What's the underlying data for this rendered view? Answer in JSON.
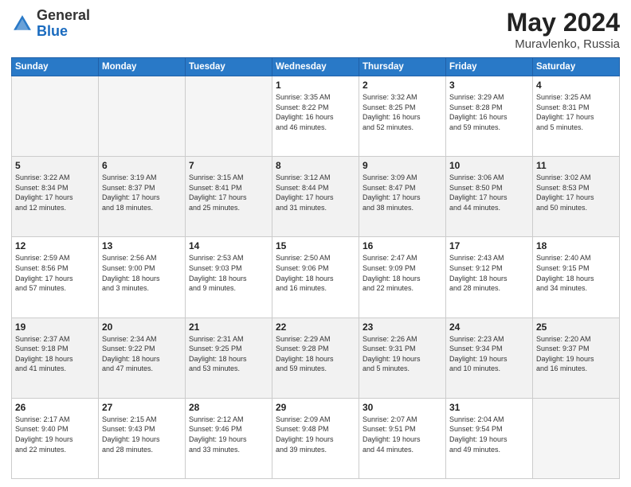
{
  "header": {
    "logo_general": "General",
    "logo_blue": "Blue",
    "title": "May 2024",
    "location": "Muravlenko, Russia"
  },
  "days_of_week": [
    "Sunday",
    "Monday",
    "Tuesday",
    "Wednesday",
    "Thursday",
    "Friday",
    "Saturday"
  ],
  "weeks": [
    [
      {
        "day": "",
        "info": ""
      },
      {
        "day": "",
        "info": ""
      },
      {
        "day": "",
        "info": ""
      },
      {
        "day": "1",
        "info": "Sunrise: 3:35 AM\nSunset: 8:22 PM\nDaylight: 16 hours\nand 46 minutes."
      },
      {
        "day": "2",
        "info": "Sunrise: 3:32 AM\nSunset: 8:25 PM\nDaylight: 16 hours\nand 52 minutes."
      },
      {
        "day": "3",
        "info": "Sunrise: 3:29 AM\nSunset: 8:28 PM\nDaylight: 16 hours\nand 59 minutes."
      },
      {
        "day": "4",
        "info": "Sunrise: 3:25 AM\nSunset: 8:31 PM\nDaylight: 17 hours\nand 5 minutes."
      }
    ],
    [
      {
        "day": "5",
        "info": "Sunrise: 3:22 AM\nSunset: 8:34 PM\nDaylight: 17 hours\nand 12 minutes."
      },
      {
        "day": "6",
        "info": "Sunrise: 3:19 AM\nSunset: 8:37 PM\nDaylight: 17 hours\nand 18 minutes."
      },
      {
        "day": "7",
        "info": "Sunrise: 3:15 AM\nSunset: 8:41 PM\nDaylight: 17 hours\nand 25 minutes."
      },
      {
        "day": "8",
        "info": "Sunrise: 3:12 AM\nSunset: 8:44 PM\nDaylight: 17 hours\nand 31 minutes."
      },
      {
        "day": "9",
        "info": "Sunrise: 3:09 AM\nSunset: 8:47 PM\nDaylight: 17 hours\nand 38 minutes."
      },
      {
        "day": "10",
        "info": "Sunrise: 3:06 AM\nSunset: 8:50 PM\nDaylight: 17 hours\nand 44 minutes."
      },
      {
        "day": "11",
        "info": "Sunrise: 3:02 AM\nSunset: 8:53 PM\nDaylight: 17 hours\nand 50 minutes."
      }
    ],
    [
      {
        "day": "12",
        "info": "Sunrise: 2:59 AM\nSunset: 8:56 PM\nDaylight: 17 hours\nand 57 minutes."
      },
      {
        "day": "13",
        "info": "Sunrise: 2:56 AM\nSunset: 9:00 PM\nDaylight: 18 hours\nand 3 minutes."
      },
      {
        "day": "14",
        "info": "Sunrise: 2:53 AM\nSunset: 9:03 PM\nDaylight: 18 hours\nand 9 minutes."
      },
      {
        "day": "15",
        "info": "Sunrise: 2:50 AM\nSunset: 9:06 PM\nDaylight: 18 hours\nand 16 minutes."
      },
      {
        "day": "16",
        "info": "Sunrise: 2:47 AM\nSunset: 9:09 PM\nDaylight: 18 hours\nand 22 minutes."
      },
      {
        "day": "17",
        "info": "Sunrise: 2:43 AM\nSunset: 9:12 PM\nDaylight: 18 hours\nand 28 minutes."
      },
      {
        "day": "18",
        "info": "Sunrise: 2:40 AM\nSunset: 9:15 PM\nDaylight: 18 hours\nand 34 minutes."
      }
    ],
    [
      {
        "day": "19",
        "info": "Sunrise: 2:37 AM\nSunset: 9:18 PM\nDaylight: 18 hours\nand 41 minutes."
      },
      {
        "day": "20",
        "info": "Sunrise: 2:34 AM\nSunset: 9:22 PM\nDaylight: 18 hours\nand 47 minutes."
      },
      {
        "day": "21",
        "info": "Sunrise: 2:31 AM\nSunset: 9:25 PM\nDaylight: 18 hours\nand 53 minutes."
      },
      {
        "day": "22",
        "info": "Sunrise: 2:29 AM\nSunset: 9:28 PM\nDaylight: 18 hours\nand 59 minutes."
      },
      {
        "day": "23",
        "info": "Sunrise: 2:26 AM\nSunset: 9:31 PM\nDaylight: 19 hours\nand 5 minutes."
      },
      {
        "day": "24",
        "info": "Sunrise: 2:23 AM\nSunset: 9:34 PM\nDaylight: 19 hours\nand 10 minutes."
      },
      {
        "day": "25",
        "info": "Sunrise: 2:20 AM\nSunset: 9:37 PM\nDaylight: 19 hours\nand 16 minutes."
      }
    ],
    [
      {
        "day": "26",
        "info": "Sunrise: 2:17 AM\nSunset: 9:40 PM\nDaylight: 19 hours\nand 22 minutes."
      },
      {
        "day": "27",
        "info": "Sunrise: 2:15 AM\nSunset: 9:43 PM\nDaylight: 19 hours\nand 28 minutes."
      },
      {
        "day": "28",
        "info": "Sunrise: 2:12 AM\nSunset: 9:46 PM\nDaylight: 19 hours\nand 33 minutes."
      },
      {
        "day": "29",
        "info": "Sunrise: 2:09 AM\nSunset: 9:48 PM\nDaylight: 19 hours\nand 39 minutes."
      },
      {
        "day": "30",
        "info": "Sunrise: 2:07 AM\nSunset: 9:51 PM\nDaylight: 19 hours\nand 44 minutes."
      },
      {
        "day": "31",
        "info": "Sunrise: 2:04 AM\nSunset: 9:54 PM\nDaylight: 19 hours\nand 49 minutes."
      },
      {
        "day": "",
        "info": ""
      }
    ]
  ]
}
